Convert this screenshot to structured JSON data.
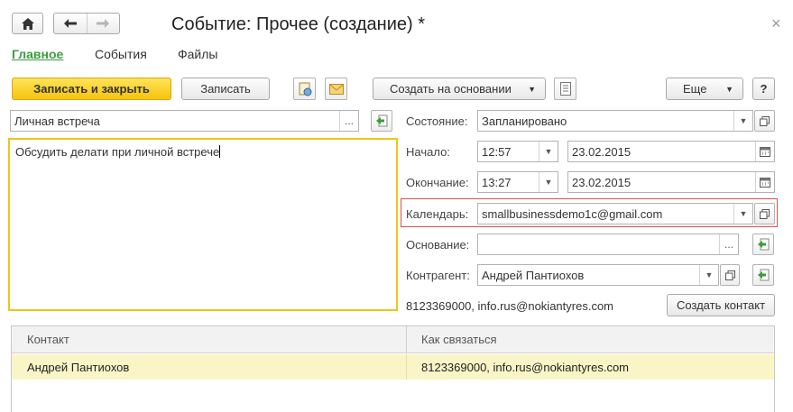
{
  "window": {
    "title": "Событие: Прочее (создание) *",
    "close_glyph": "×"
  },
  "tabs": [
    "Главное",
    "События",
    "Файлы"
  ],
  "toolbar": {
    "save_close": "Записать и закрыть",
    "save": "Записать",
    "create_based": "Создать на основании",
    "more": "Еще",
    "help": "?"
  },
  "form": {
    "subject": "Личная встреча",
    "description": "Обсудить делати при личной встрече",
    "state_label": "Состояние:",
    "state_value": "Запланировано",
    "start_label": "Начало:",
    "start_time": "12:57",
    "start_date": "23.02.2015",
    "end_label": "Окончание:",
    "end_time": "13:27",
    "end_date": "23.02.2015",
    "calendar_label": "Календарь:",
    "calendar_value": "smallbusinessdemo1c@gmail.com",
    "basis_label": "Основание:",
    "basis_value": "",
    "contractor_label": "Контрагент:",
    "contractor_value": "Андрей Пантиохов",
    "contact_info": "8123369000, info.rus@nokiantyres.com",
    "create_contact": "Создать контакт",
    "ellipsis": "..."
  },
  "table": {
    "columns": [
      "Контакт",
      "Как связаться"
    ],
    "rows": [
      {
        "contact": "Андрей Пантиохов",
        "how": "8123369000, info.rus@nokiantyres.com"
      }
    ]
  },
  "colors": {
    "accent_green": "#3b9e3f",
    "primary_yellow": "#f5c40a",
    "focus_border": "#f0c419",
    "highlight_red": "#d9534f"
  }
}
